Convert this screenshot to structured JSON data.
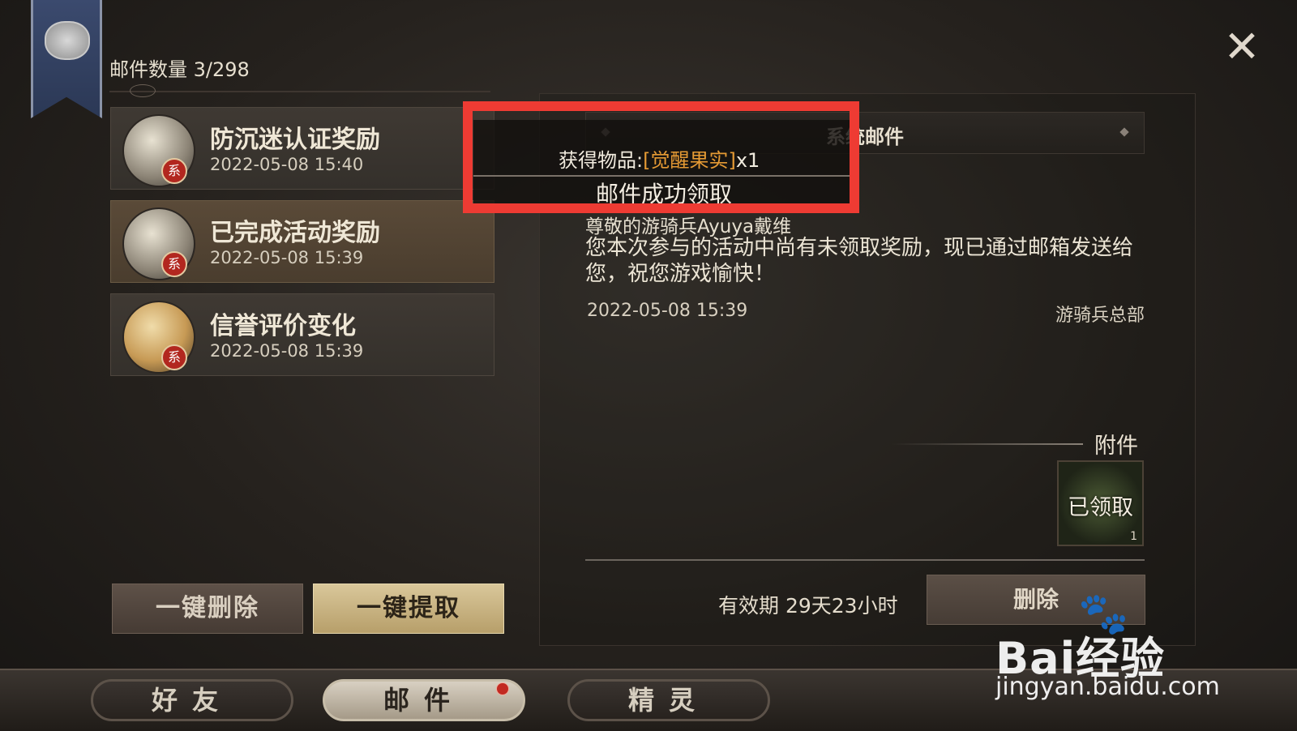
{
  "mailbox": {
    "count_label": "邮件数量 3/298",
    "items": [
      {
        "title": "防沉迷认证奖励",
        "date": "2022-05-08 15:40",
        "badge": "系"
      },
      {
        "title": "已完成活动奖励",
        "date": "2022-05-08 15:39",
        "badge": "系"
      },
      {
        "title": "信誉评价变化",
        "date": "2022-05-08 15:39",
        "badge": "系"
      }
    ],
    "delete_all_label": "一键删除",
    "take_all_label": "一键提取"
  },
  "detail": {
    "header_title": "系统邮件",
    "salutation": "尊敬的游骑兵Ayuya戴维",
    "body": "您本次参与的活动中尚有未领取奖励，现已通过邮箱发送给您，祝您游戏愉快！",
    "time": "2022-05-08 15:39",
    "sender": "游骑兵总部",
    "attachment_label": "附件",
    "attachment_status": "已领取",
    "attachment_qty": "1",
    "validity": "有效期 29天23小时",
    "delete_label": "删除"
  },
  "popup": {
    "item_prefix": "获得物品:",
    "item_name": "[觉醒果实]",
    "item_qty": "x1",
    "success": "邮件成功领取"
  },
  "close_icon": "close-icon",
  "tabs": [
    {
      "label": "好友"
    },
    {
      "label": "邮件"
    },
    {
      "label": "精灵"
    }
  ],
  "watermark": {
    "brand": "Bai经验",
    "url": "jingyan.baidu.com"
  },
  "colors": {
    "highlight": "#ee3b33",
    "item_name": "#e59a34"
  }
}
